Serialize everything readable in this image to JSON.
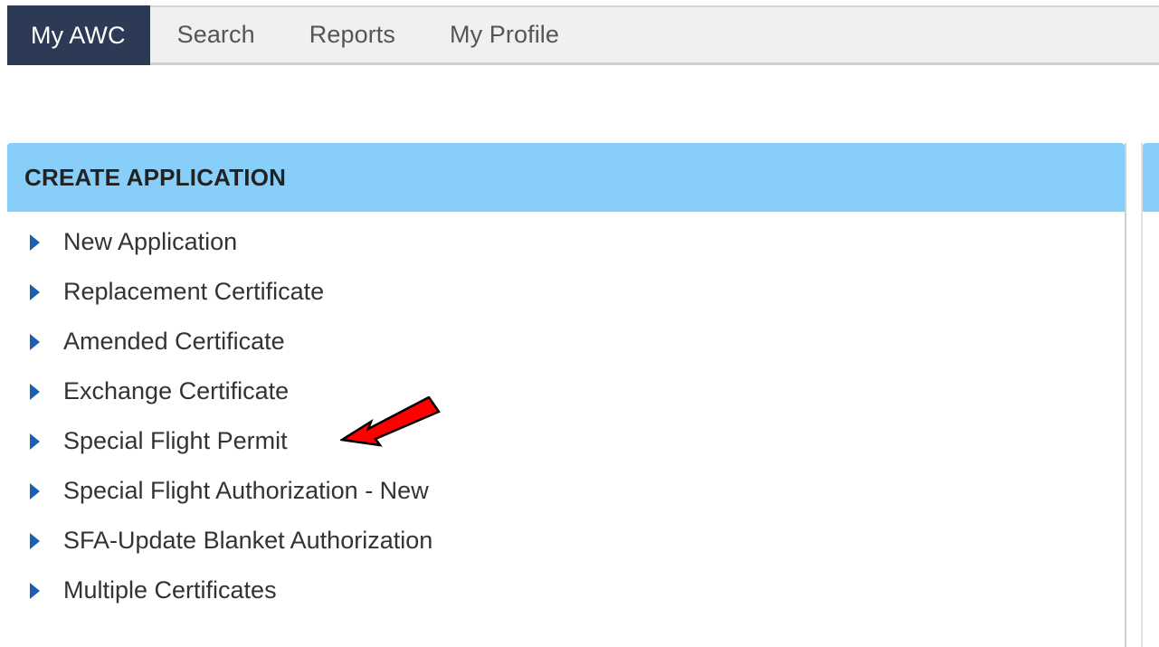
{
  "nav": {
    "tabs": [
      {
        "label": "My AWC",
        "active": true
      },
      {
        "label": "Search",
        "active": false
      },
      {
        "label": "Reports",
        "active": false
      },
      {
        "label": "My Profile",
        "active": false
      }
    ]
  },
  "panel": {
    "title": "CREATE APPLICATION",
    "items": [
      {
        "label": "New Application"
      },
      {
        "label": "Replacement Certificate"
      },
      {
        "label": "Amended Certificate"
      },
      {
        "label": "Exchange Certificate"
      },
      {
        "label": "Special Flight Permit"
      },
      {
        "label": "Special Flight Authorization - New"
      },
      {
        "label": "SFA-Update Blanket Authorization"
      },
      {
        "label": "Multiple Certificates"
      }
    ]
  },
  "colors": {
    "nav_active_bg": "#2c3a55",
    "panel_header_bg": "#87cef8",
    "caret": "#1a5fb4",
    "annotation_arrow": "#ff0000"
  },
  "icons": {
    "menu_bullet": "caret-right-icon",
    "annotation": "red-arrow-icon"
  }
}
